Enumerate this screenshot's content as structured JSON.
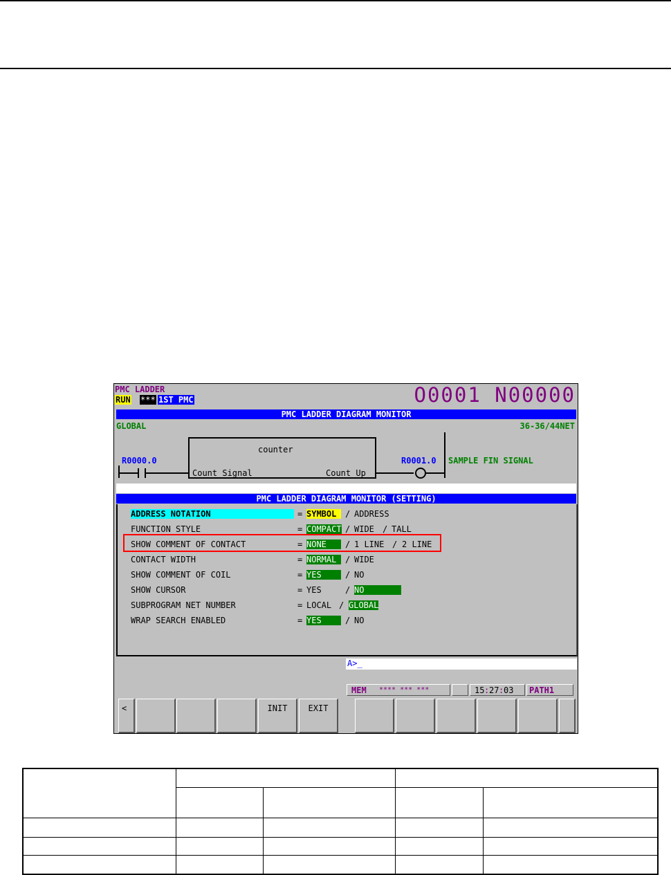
{
  "screen": {
    "mode_label": "PMC LADDER",
    "status_run": "RUN",
    "status_stars": "***",
    "status_pmc": "1ST PMC",
    "program_number": "O0001 N00000",
    "monitor_title": "PMC LADDER DIAGRAM MONITOR",
    "scope": "GLOBAL",
    "net_position": "36-36/44NET",
    "ladder": {
      "contact_address": "R0000.0",
      "function_name": "counter",
      "input_label": "Count Signal",
      "output_label": "Count Up",
      "coil_address": "R0001.0",
      "coil_comment": "SAMPLE FIN SIGNAL"
    },
    "setting_title": "PMC LADDER DIAGRAM MONITOR (SETTING)",
    "settings": [
      {
        "label": "ADDRESS NOTATION",
        "eq": "=",
        "opt1": "SYMBOL",
        "sep1": "/",
        "opt2": "ADDRESS"
      },
      {
        "label": "FUNCTION STYLE",
        "eq": "=",
        "opt1": "COMPACT",
        "sep1": "/",
        "opt2": "WIDE",
        "sep2": "/",
        "opt3": "TALL"
      },
      {
        "label": "SHOW COMMENT OF CONTACT",
        "eq": "=",
        "opt1": "NONE",
        "sep1": "/",
        "opt2": "1 LINE",
        "sep2": "/",
        "opt3": "2 LINE"
      },
      {
        "label": "CONTACT WIDTH",
        "eq": "=",
        "opt1": "NORMAL",
        "sep1": "/",
        "opt2": "WIDE"
      },
      {
        "label": "SHOW COMMENT OF COIL",
        "eq": "=",
        "opt1": "YES",
        "sep1": "/",
        "opt2": "NO"
      },
      {
        "label": "SHOW CURSOR",
        "eq": "=",
        "opt1": "YES",
        "sep1": "/",
        "opt2": "NO"
      },
      {
        "label": "SUBPROGRAM NET NUMBER",
        "eq": "=",
        "opt1": "LOCAL",
        "sep1": "/",
        "opt2": "GLOBAL"
      },
      {
        "label": "WRAP SEARCH ENABLED",
        "eq": "=",
        "opt1": "YES",
        "sep1": "/",
        "opt2": "NO"
      }
    ],
    "prompt": "A>_",
    "status_mode": "MEM",
    "status_stars_line": "**** *** ***",
    "clock_hh": "15",
    "clock_mm": "27",
    "clock_ss": "03",
    "path_label": "PATH1",
    "softkeys": {
      "prev": "<",
      "init": "INIT",
      "exit": "EXIT"
    },
    "colors": {
      "highlight_selected": "#008000",
      "highlight_cursor": "#ffff00",
      "title_bar": "#0000ff",
      "annotation_box": "#ff0000"
    }
  }
}
